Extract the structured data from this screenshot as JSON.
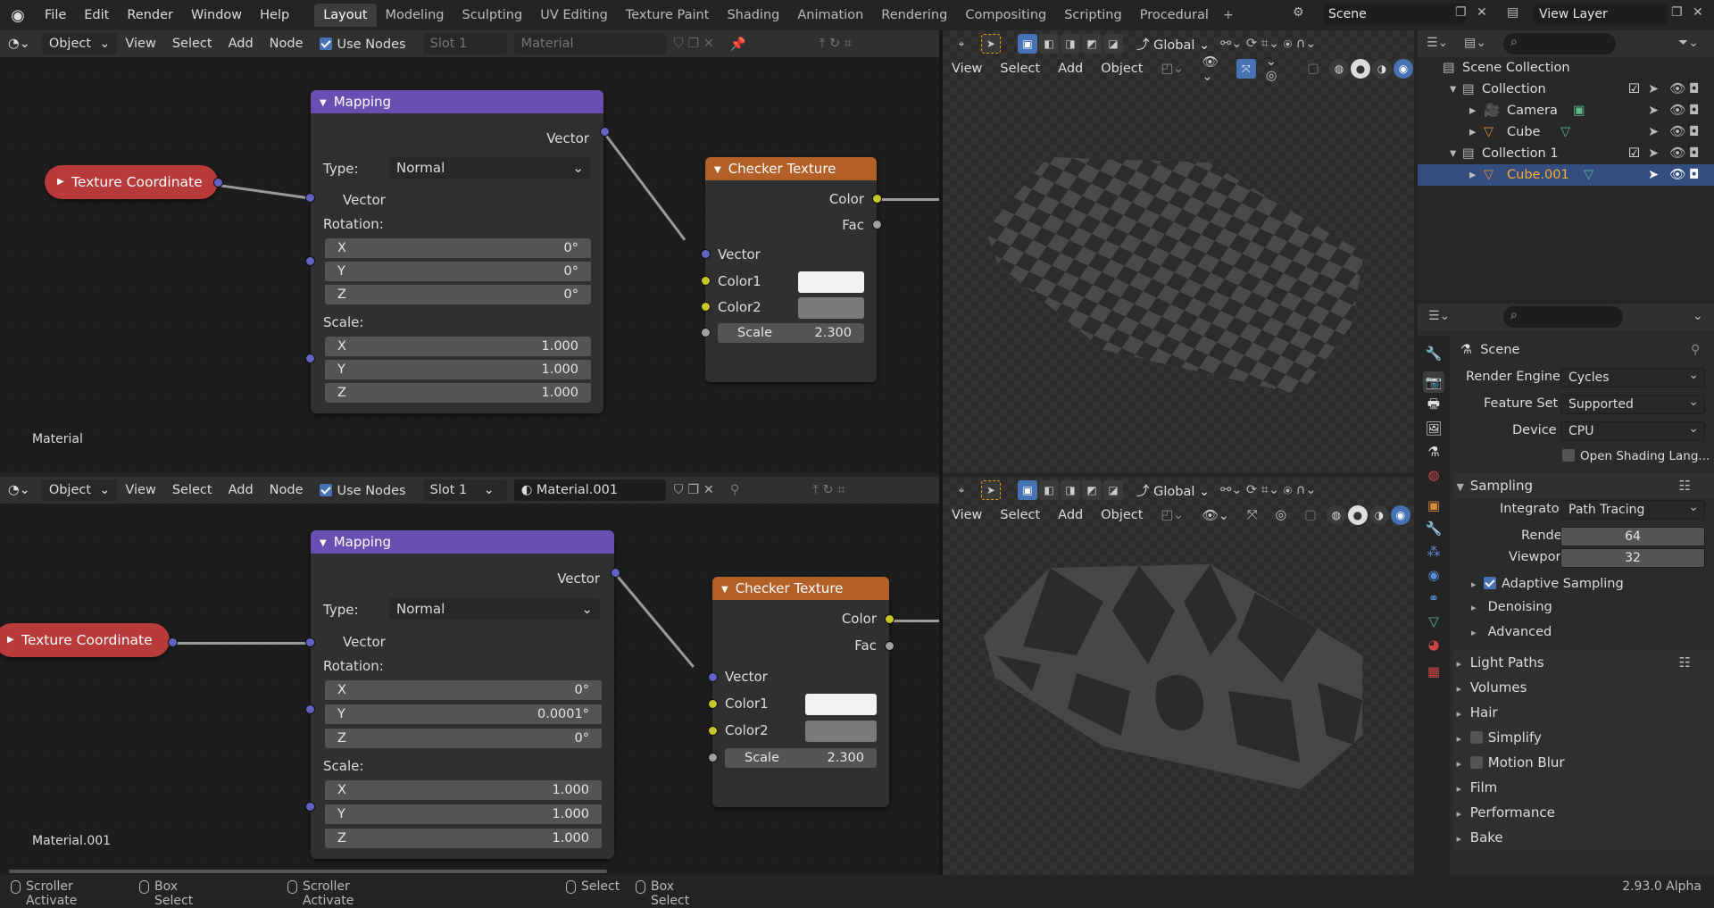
{
  "menu": [
    "File",
    "Edit",
    "Render",
    "Window",
    "Help"
  ],
  "workspaces": [
    "Layout",
    "Modeling",
    "Sculpting",
    "UV Editing",
    "Texture Paint",
    "Shading",
    "Animation",
    "Rendering",
    "Compositing",
    "Scripting",
    "Procedural"
  ],
  "active_workspace": "Layout",
  "scene_label": "Scene",
  "view_layer_label": "View Layer",
  "node_editor_top": {
    "object_mode": "Object",
    "menus": [
      "View",
      "Select",
      "Add",
      "Node"
    ],
    "use_nodes_label": "Use Nodes",
    "slot": "Slot 1",
    "material": "Material",
    "material_label": "Material",
    "mapping": {
      "title": "Mapping",
      "vector_out": "Vector",
      "type_label": "Type:",
      "type_value": "Normal",
      "vector_in": "Vector",
      "rotation_label": "Rotation:",
      "rot": [
        {
          "axis": "X",
          "val": "0°"
        },
        {
          "axis": "Y",
          "val": "0°"
        },
        {
          "axis": "Z",
          "val": "0°"
        }
      ],
      "scale_label": "Scale:",
      "scale": [
        {
          "axis": "X",
          "val": "1.000"
        },
        {
          "axis": "Y",
          "val": "1.000"
        },
        {
          "axis": "Z",
          "val": "1.000"
        }
      ]
    },
    "texcoord": "Texture Coordinate",
    "checker": {
      "title": "Checker Texture",
      "color_out": "Color",
      "fac_out": "Fac",
      "vector_in": "Vector",
      "color1": "Color1",
      "color2": "Color2",
      "scale_label": "Scale",
      "scale_val": "2.300"
    }
  },
  "node_editor_bottom": {
    "object_mode": "Object",
    "menus": [
      "View",
      "Select",
      "Add",
      "Node"
    ],
    "use_nodes_label": "Use Nodes",
    "slot": "Slot 1",
    "material": "Material.001",
    "material_label": "Material.001",
    "mapping": {
      "title": "Mapping",
      "vector_out": "Vector",
      "type_label": "Type:",
      "type_value": "Normal",
      "vector_in": "Vector",
      "rotation_label": "Rotation:",
      "rot": [
        {
          "axis": "X",
          "val": "0°"
        },
        {
          "axis": "Y",
          "val": "0.0001°"
        },
        {
          "axis": "Z",
          "val": "0°"
        }
      ],
      "scale_label": "Scale:",
      "scale": [
        {
          "axis": "X",
          "val": "1.000"
        },
        {
          "axis": "Y",
          "val": "1.000"
        },
        {
          "axis": "Z",
          "val": "1.000"
        }
      ]
    },
    "texcoord": "Texture Coordinate",
    "checker": {
      "title": "Checker Texture",
      "color_out": "Color",
      "fac_out": "Fac",
      "vector_in": "Vector",
      "color1": "Color1",
      "color2": "Color2",
      "scale_label": "Scale",
      "scale_val": "2.300"
    }
  },
  "viewport": {
    "orientation": "Global",
    "menus": [
      "View",
      "Select",
      "Add",
      "Object"
    ]
  },
  "outliner": {
    "root": "Scene Collection",
    "items": [
      {
        "name": "Collection"
      },
      {
        "name": "Camera"
      },
      {
        "name": "Cube"
      },
      {
        "name": "Collection 1"
      },
      {
        "name": "Cube.001"
      }
    ]
  },
  "properties": {
    "context": "Scene",
    "render_engine_label": "Render Engine",
    "render_engine": "Cycles",
    "feature_set_label": "Feature Set",
    "feature_set": "Supported",
    "device_label": "Device",
    "device": "CPU",
    "osl_label": "Open Shading Lang...",
    "sampling_label": "Sampling",
    "integrator_label": "Integrator",
    "integrator": "Path Tracing",
    "render_label": "Render",
    "render_samples": "64",
    "viewport_label": "Viewport",
    "viewport_samples": "32",
    "adaptive_label": "Adaptive Sampling",
    "denoising_label": "Denoising",
    "advanced_label": "Advanced",
    "panels": [
      "Light Paths",
      "Volumes",
      "Hair",
      "Simplify",
      "Motion Blur",
      "Film",
      "Performance",
      "Bake"
    ]
  },
  "status": {
    "items": [
      "Scroller Activate",
      "Box Select",
      "Scroller Activate",
      "Select",
      "Box Select"
    ],
    "version": "2.93.0 Alpha"
  },
  "colors": {
    "mapping_header": "#6a4fb3",
    "checker_header": "#b35f28",
    "texcoord": "#b83a3a",
    "accent": "#4772b3"
  }
}
